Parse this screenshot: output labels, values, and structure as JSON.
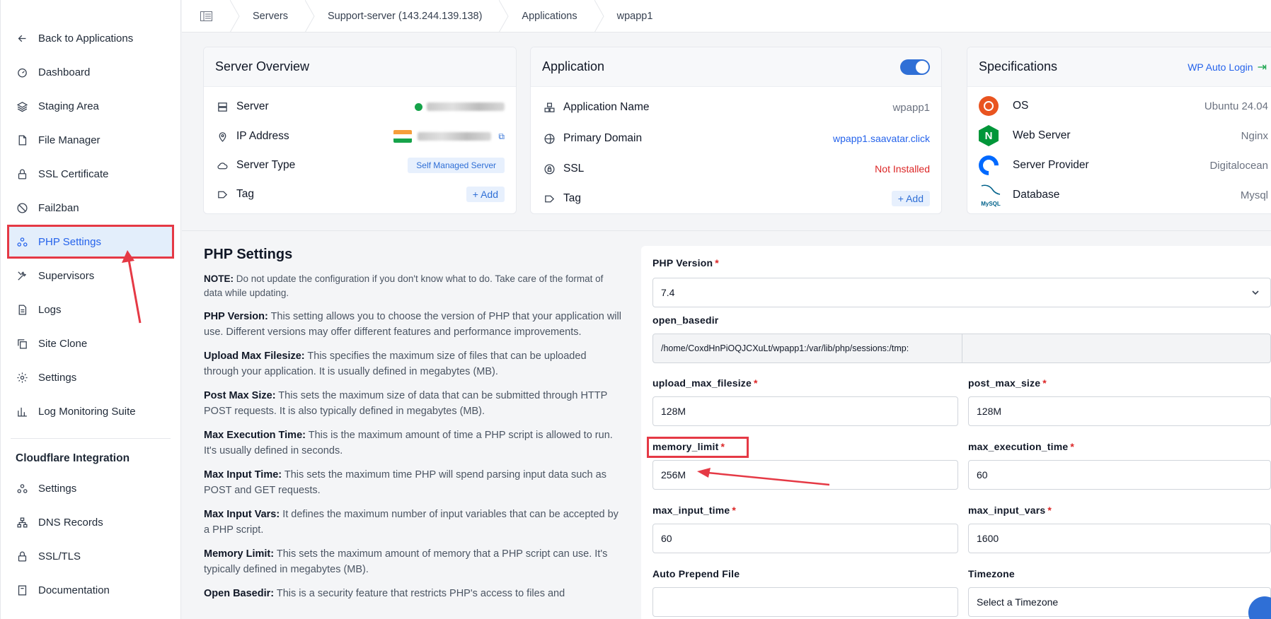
{
  "sidebar": {
    "back": "Back to Applications",
    "items": [
      {
        "label": "Dashboard",
        "icon": "gauge-icon"
      },
      {
        "label": "Staging Area",
        "icon": "layers-icon"
      },
      {
        "label": "File Manager",
        "icon": "file-icon"
      },
      {
        "label": "SSL Certificate",
        "icon": "lock-icon"
      },
      {
        "label": "Fail2ban",
        "icon": "ban-icon"
      },
      {
        "label": "PHP Settings",
        "icon": "nodes-icon",
        "active": true
      },
      {
        "label": "Supervisors",
        "icon": "tools-icon"
      },
      {
        "label": "Logs",
        "icon": "document-icon"
      },
      {
        "label": "Site Clone",
        "icon": "copy-icon"
      },
      {
        "label": "Settings",
        "icon": "gear-icon"
      },
      {
        "label": "Log Monitoring Suite",
        "icon": "bar-chart-icon"
      }
    ],
    "cloudflare_title": "Cloudflare Integration",
    "cloudflare_items": [
      {
        "label": "Settings",
        "icon": "nodes-icon"
      },
      {
        "label": "DNS Records",
        "icon": "sitemap-icon"
      },
      {
        "label": "SSL/TLS",
        "icon": "lock-icon"
      },
      {
        "label": "Documentation",
        "icon": "book-icon"
      }
    ]
  },
  "breadcrumb": [
    "Servers",
    "Support-server (143.244.139.138)",
    "Applications",
    "wpapp1"
  ],
  "server_overview": {
    "title": "Server Overview",
    "server_label": "Server",
    "ip_label": "IP Address",
    "type_label": "Server Type",
    "type_value": "Self Managed Server",
    "tag_label": "Tag",
    "add_label": "+ Add"
  },
  "application": {
    "title": "Application",
    "name_label": "Application Name",
    "name_value": "wpapp1",
    "domain_label": "Primary Domain",
    "domain_value": "wpapp1.saavatar.click",
    "ssl_label": "SSL",
    "ssl_value": "Not Installed",
    "tag_label": "Tag",
    "add_label": "+ Add",
    "enabled": true
  },
  "specifications": {
    "title": "Specifications",
    "auto_login": "WP Auto Login",
    "os_label": "OS",
    "os_value": "Ubuntu 24.04",
    "web_label": "Web Server",
    "web_value": "Nginx",
    "provider_label": "Server Provider",
    "provider_value": "Digitalocean",
    "db_label": "Database",
    "db_value": "Mysql",
    "mysql_logo_text": "MySQL"
  },
  "php": {
    "title": "PHP Settings",
    "note_label": "NOTE:",
    "note_text": " Do not update the configuration if you don't know what to do. Take care of the format of data while updating.",
    "descriptions": [
      {
        "term": "PHP Version:",
        "text": " This setting allows you to choose the version of PHP that your application will use. Different versions may offer different features and performance improvements."
      },
      {
        "term": "Upload Max Filesize:",
        "text": " This specifies the maximum size of files that can be uploaded through your application. It is usually defined in megabytes (MB)."
      },
      {
        "term": "Post Max Size:",
        "text": " This sets the maximum size of data that can be submitted through HTTP POST requests. It is also typically defined in megabytes (MB)."
      },
      {
        "term": "Max Execution Time:",
        "text": " This is the maximum amount of time a PHP script is allowed to run. It's usually defined in seconds."
      },
      {
        "term": "Max Input Time:",
        "text": " This sets the maximum time PHP will spend parsing input data such as POST and GET requests."
      },
      {
        "term": "Max Input Vars:",
        "text": " It defines the maximum number of input variables that can be accepted by a PHP script."
      },
      {
        "term": "Memory Limit:",
        "text": " This sets the maximum amount of memory that a PHP script can use. It's typically defined in megabytes (MB)."
      },
      {
        "term": "Open Basedir:",
        "text": " This is a security feature that restricts PHP's access to files and"
      }
    ]
  },
  "form": {
    "php_version_label": "PHP Version",
    "php_version_value": "7.4",
    "open_basedir_label": "open_basedir",
    "open_basedir_value": "/home/CoxdHnPiOQJCXuLt/wpapp1:/var/lib/php/sessions:/tmp:",
    "upload_label": "upload_max_filesize",
    "upload_value": "128M",
    "post_label": "post_max_size",
    "post_value": "128M",
    "memory_label": "memory_limit",
    "memory_value": "256M",
    "exec_label": "max_execution_time",
    "exec_value": "60",
    "input_time_label": "max_input_time",
    "input_time_value": "60",
    "input_vars_label": "max_input_vars",
    "input_vars_value": "1600",
    "prepend_label": "Auto Prepend File",
    "prepend_value": "",
    "timezone_label": "Timezone",
    "timezone_placeholder": "Select a Timezone",
    "required_mark": "*"
  },
  "colors": {
    "accent": "#2563eb",
    "annotation": "#e53945",
    "danger": "#dc2626"
  }
}
